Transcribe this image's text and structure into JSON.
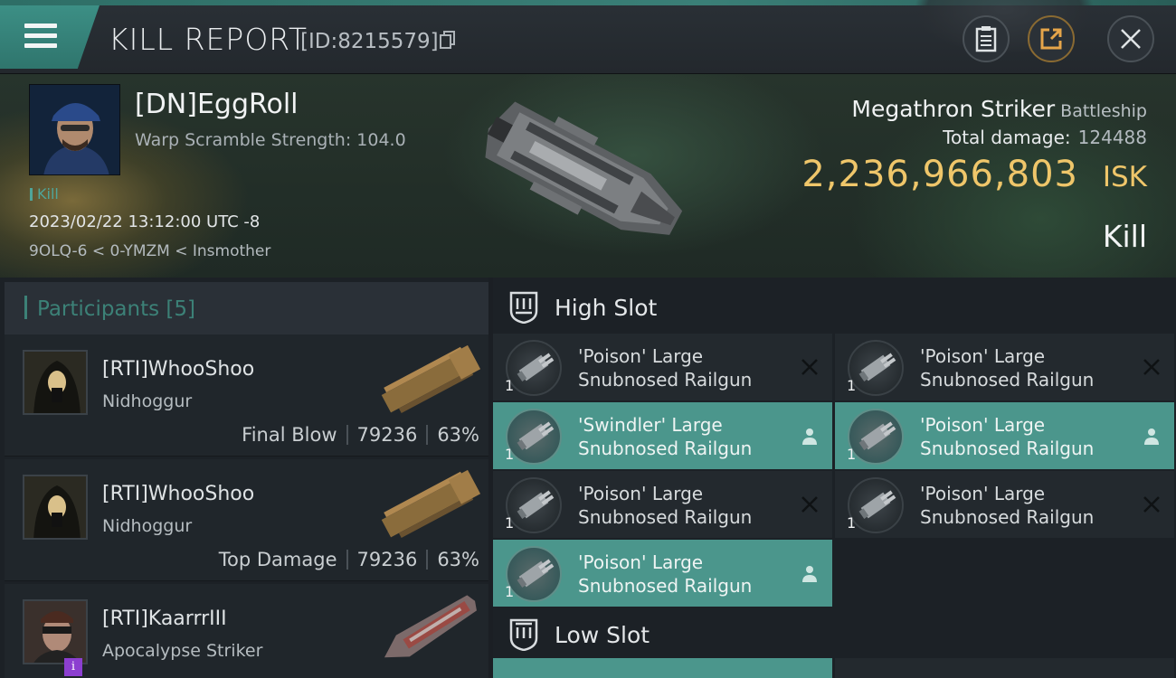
{
  "header": {
    "title": "KILL REPORT",
    "report_id": "[ID:8215579]"
  },
  "victim": {
    "name": "[DN]EggRoll",
    "warp_scramble": "Warp Scramble Strength: 104.0",
    "tag": "Kill",
    "datetime": "2023/02/22 13:12:00 UTC -8",
    "location": "9OLQ-6 < 0-YMZM < Insmother",
    "ship_name": "Megathron Striker",
    "ship_class": "Battleship",
    "total_damage_label": "Total damage:",
    "total_damage_value": "124488",
    "isk_value": "2,236,966,803",
    "isk_unit": "ISK",
    "result": "Kill"
  },
  "participants": {
    "title": "Participants",
    "count": "[5]",
    "rows": [
      {
        "name": "[RTI]WhooShoo",
        "ship": "Nidhoggur",
        "role": "Final Blow",
        "damage": "79236",
        "percent": "63%"
      },
      {
        "name": "[RTI]WhooShoo",
        "ship": "Nidhoggur",
        "role": "Top Damage",
        "damage": "79236",
        "percent": "63%"
      },
      {
        "name": "[RTI]KaarrrIII",
        "ship": "Apocalypse Striker",
        "badge": "i"
      }
    ]
  },
  "slots": {
    "high_label": "High Slot",
    "low_label": "Low Slot",
    "high": [
      {
        "line1": "'Poison' Large",
        "line2": "Snubnosed Railgun",
        "qty": "1",
        "state": "destroyed"
      },
      {
        "line1": "'Poison' Large",
        "line2": "Snubnosed Railgun",
        "qty": "1",
        "state": "destroyed"
      },
      {
        "line1": "'Swindler' Large",
        "line2": "Snubnosed Railgun",
        "qty": "1",
        "state": "dropped"
      },
      {
        "line1": "'Poison' Large",
        "line2": "Snubnosed Railgun",
        "qty": "1",
        "state": "dropped"
      },
      {
        "line1": "'Poison' Large",
        "line2": "Snubnosed Railgun",
        "qty": "1",
        "state": "destroyed"
      },
      {
        "line1": "'Poison' Large",
        "line2": "Snubnosed Railgun",
        "qty": "1",
        "state": "destroyed"
      },
      {
        "line1": "'Poison' Large",
        "line2": "Snubnosed Railgun",
        "qty": "1",
        "state": "dropped"
      }
    ]
  },
  "colors": {
    "accent": "#3c8177",
    "isk_gold": "#efc66a",
    "dropped_bg": "#4b968c"
  }
}
